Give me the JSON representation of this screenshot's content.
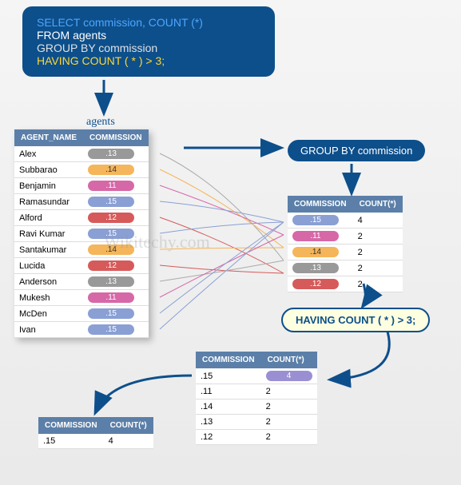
{
  "sql": {
    "select": "SELECT commission, COUNT (*)",
    "from": "FROM agents",
    "group": "GROUP BY commission",
    "having": "HAVING COUNT ( * ) > 3;"
  },
  "agents_label": "agents",
  "agents_table": {
    "headers": [
      "AGENT_NAME",
      "COMMISSION"
    ],
    "rows": [
      {
        "name": "Alex",
        "commission": ".13",
        "color": "gray"
      },
      {
        "name": "Subbarao",
        "commission": ".14",
        "color": "orange"
      },
      {
        "name": "Benjamin",
        "commission": ".11",
        "color": "pink"
      },
      {
        "name": "Ramasundar",
        "commission": ".15",
        "color": "blue"
      },
      {
        "name": "Alford",
        "commission": ".12",
        "color": "red"
      },
      {
        "name": "Ravi Kumar",
        "commission": ".15",
        "color": "blue"
      },
      {
        "name": "Santakumar",
        "commission": ".14",
        "color": "orange"
      },
      {
        "name": "Lucida",
        "commission": ".12",
        "color": "red"
      },
      {
        "name": "Anderson",
        "commission": ".13",
        "color": "gray"
      },
      {
        "name": "Mukesh",
        "commission": ".11",
        "color": "pink"
      },
      {
        "name": "McDen",
        "commission": ".15",
        "color": "blue"
      },
      {
        "name": "Ivan",
        "commission": ".15",
        "color": "blue"
      }
    ]
  },
  "groupby_bubble": "GROUP BY commission",
  "grouped_table": {
    "headers": [
      "COMMISSION",
      "COUNT(*)"
    ],
    "rows": [
      {
        "commission": ".15",
        "count": "4",
        "color": "blue"
      },
      {
        "commission": ".11",
        "count": "2",
        "color": "pink"
      },
      {
        "commission": ".14",
        "count": "2",
        "color": "orange"
      },
      {
        "commission": ".13",
        "count": "2",
        "color": "gray"
      },
      {
        "commission": ".12",
        "count": "2",
        "color": "red"
      }
    ]
  },
  "having_bubble": "HAVING COUNT ( * ) > 3;",
  "having_table": {
    "headers": [
      "COMMISSION",
      "COUNT(*)"
    ],
    "rows": [
      {
        "commission": ".15",
        "count": "4",
        "color": "purple",
        "highlight": true
      },
      {
        "commission": ".11",
        "count": "2"
      },
      {
        "commission": ".14",
        "count": "2"
      },
      {
        "commission": ".13",
        "count": "2"
      },
      {
        "commission": ".12",
        "count": "2"
      }
    ]
  },
  "result_table": {
    "headers": [
      "COMMISSION",
      "COUNT(*)"
    ],
    "rows": [
      {
        "commission": ".15",
        "count": "4"
      }
    ]
  },
  "watermark": "Wikitechy.com"
}
